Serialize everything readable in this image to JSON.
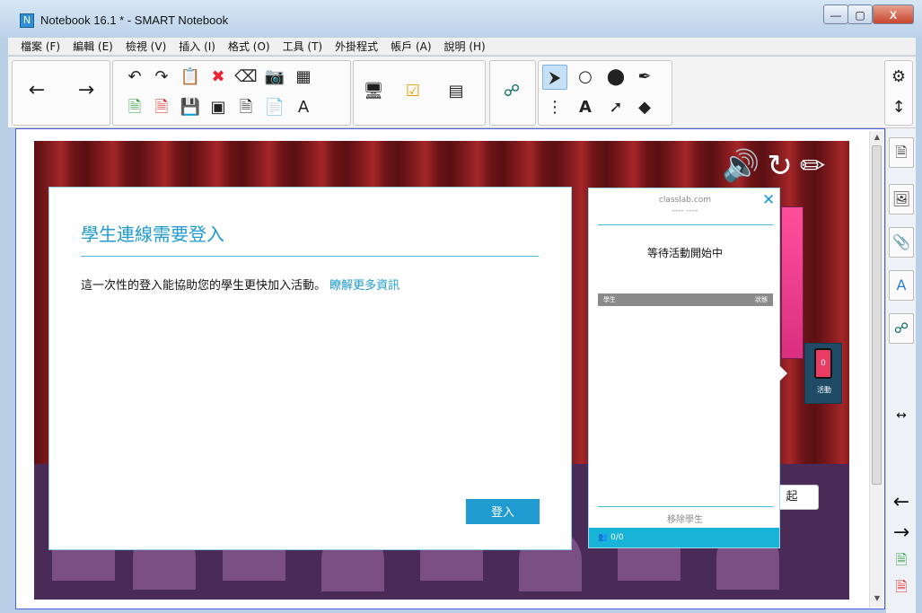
{
  "window": {
    "title": "Notebook 16.1 * - SMART Notebook",
    "app_icon_glyph": "N",
    "controls": {
      "minimize": "—",
      "maximize": "▢",
      "close": "X"
    }
  },
  "menu": [
    "檔案 (F)",
    "編輯 (E)",
    "檢視 (V)",
    "插入 (I)",
    "格式 (O)",
    "工具 (T)",
    "外掛程式",
    "帳戶 (A)",
    "說明 (H)"
  ],
  "toolbar": {
    "icons": {
      "back": "arrow-left-icon",
      "forward": "arrow-right-icon",
      "undo": "undo-icon",
      "redo": "redo-icon",
      "paste": "paste-icon",
      "delete": "delete-icon",
      "eraser_small": "eraser-icon",
      "camera": "screen-capture-icon",
      "table": "table-icon",
      "add_page": "add-page-icon",
      "delete_page": "delete-page-icon",
      "save": "save-icon",
      "screen_shade": "screen-shade-icon",
      "insert_file": "insert-file-icon",
      "paste_special": "paste-special-icon",
      "text_tool": "text-format-icon",
      "display": "display-icon",
      "response": "response-icon",
      "addon": "addon-icon",
      "puzzle": "puzzle-icon",
      "select": "select-arrow-icon",
      "shapes": "shapes-icon",
      "fill": "fill-icon",
      "pen_tool": "pen-icon",
      "pen_style": "pen-style-icon",
      "text": "text-icon",
      "line": "line-icon",
      "eraser": "eraser-icon",
      "settings": "gear-icon",
      "move": "move-icon"
    }
  },
  "login": {
    "title": "學生連線需要登入",
    "description": "這一次性的登入能協助您的學生更快加入活動。",
    "link": "瞭解更多資訊",
    "button": "登入"
  },
  "panel": {
    "domain": "classlab.com",
    "dash": "---- ----",
    "close": "✕",
    "status": "等待活動開始中",
    "header_left": "學生",
    "header_right": "狀態",
    "remove": "移除學生",
    "count": "0/0"
  },
  "activity": {
    "label": "活動",
    "phone_value": "0"
  },
  "stage": {
    "hidden_button_label": "起"
  },
  "colors": {
    "accent": "#1f9bd1",
    "curtain": "#8a1f22",
    "panel_footer": "#18b4d8"
  }
}
